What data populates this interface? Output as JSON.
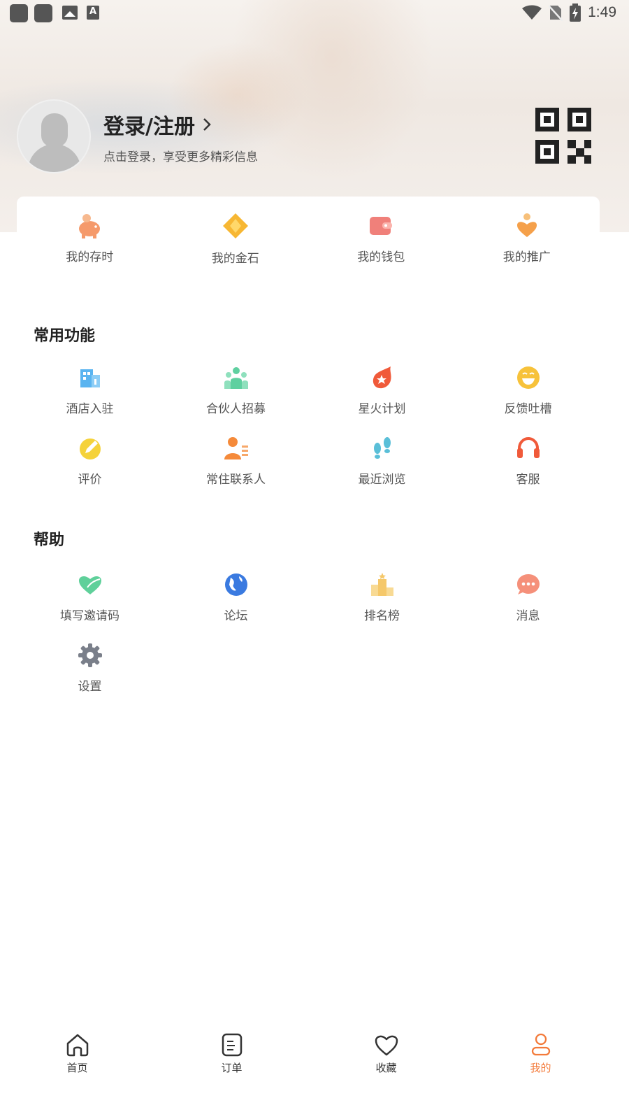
{
  "status_bar": {
    "time": "1:49"
  },
  "profile": {
    "title": "登录/注册",
    "subtitle": "点击登录，享受更多精彩信息"
  },
  "assets": [
    {
      "label": "我的存时",
      "icon": "piggy-bank-icon",
      "color": "#f59a6b"
    },
    {
      "label": "我的金石",
      "icon": "diamond-icon",
      "color": "#f7b733"
    },
    {
      "label": "我的钱包",
      "icon": "wallet-icon",
      "color": "#f0807a"
    },
    {
      "label": "我的推广",
      "icon": "heart-person-icon",
      "color": "#f5a04a"
    }
  ],
  "common": {
    "title": "常用功能",
    "items": [
      {
        "label": "酒店入驻",
        "icon": "hotel-icon",
        "color": "#5ab4f0"
      },
      {
        "label": "合伙人招募",
        "icon": "partners-icon",
        "color": "#5fd0a0"
      },
      {
        "label": "星火计划",
        "icon": "spark-icon",
        "color": "#f05a3a"
      },
      {
        "label": "反馈吐槽",
        "icon": "smile-icon",
        "color": "#f7c23a"
      },
      {
        "label": "评价",
        "icon": "review-icon",
        "color": "#f5d23a"
      },
      {
        "label": "常住联系人",
        "icon": "contact-icon",
        "color": "#f58a3a"
      },
      {
        "label": "最近浏览",
        "icon": "footprint-icon",
        "color": "#5abfd8"
      },
      {
        "label": "客服",
        "icon": "headset-icon",
        "color": "#f05a3a"
      }
    ]
  },
  "help": {
    "title": "帮助",
    "items": [
      {
        "label": "填写邀请码",
        "icon": "invite-heart-icon",
        "color": "#5fd09a"
      },
      {
        "label": "论坛",
        "icon": "globe-icon",
        "color": "#3a7ae0"
      },
      {
        "label": "排名榜",
        "icon": "podium-icon",
        "color": "#f5c86a"
      },
      {
        "label": "消息",
        "icon": "chat-icon",
        "color": "#f5907a"
      },
      {
        "label": "设置",
        "icon": "gear-icon",
        "color": "#7a7f8a"
      }
    ]
  },
  "tabbar": [
    {
      "label": "首页",
      "icon": "home-icon",
      "active": false
    },
    {
      "label": "订单",
      "icon": "order-icon",
      "active": false
    },
    {
      "label": "收藏",
      "icon": "heart-icon",
      "active": false
    },
    {
      "label": "我的",
      "icon": "profile-icon",
      "active": true
    }
  ],
  "colors": {
    "accent": "#f37a3a",
    "text": "#333333"
  }
}
